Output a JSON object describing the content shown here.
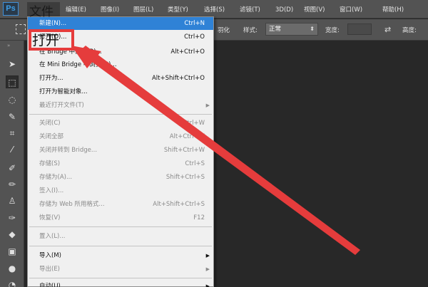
{
  "app": {
    "logo": "Ps"
  },
  "menubar": {
    "file_label": "文件",
    "items": [
      "编辑(E)",
      "图像(I)",
      "图层(L)",
      "类型(Y)",
      "选择(S)",
      "滤镜(T)",
      "3D(D)",
      "视图(V)",
      "窗口(W)",
      "帮助(H)"
    ]
  },
  "optbar": {
    "feather_label": "羽化",
    "style_label": "样式:",
    "style_value": "正常",
    "width_label": "宽度:",
    "height_label": "高度:"
  },
  "file_menu": {
    "items": [
      {
        "label": "新建(N)...",
        "shortcut": "Ctrl+N",
        "state": "highlight"
      },
      {
        "label": "打开(O)...",
        "shortcut": "Ctrl+O",
        "state": "normal"
      },
      {
        "label": "在 Bridge 中浏览(B)...",
        "shortcut": "Alt+Ctrl+O",
        "state": "normal"
      },
      {
        "label": "在 Mini Bridge 中浏览(G)...",
        "shortcut": "",
        "state": "normal"
      },
      {
        "label": "打开为...",
        "shortcut": "Alt+Shift+Ctrl+O",
        "state": "normal"
      },
      {
        "label": "打开为智能对象...",
        "shortcut": "",
        "state": "normal"
      },
      {
        "label": "最近打开文件(T)",
        "shortcut": "",
        "state": "disabled",
        "submenu": true
      },
      {
        "label": "关闭(C)",
        "shortcut": "Ctrl+W",
        "state": "disabled"
      },
      {
        "label": "关闭全部",
        "shortcut": "Alt+Ctrl+W",
        "state": "disabled"
      },
      {
        "label": "关闭并转到 Bridge...",
        "shortcut": "Shift+Ctrl+W",
        "state": "disabled"
      },
      {
        "label": "存储(S)",
        "shortcut": "Ctrl+S",
        "state": "disabled"
      },
      {
        "label": "存储为(A)...",
        "shortcut": "Shift+Ctrl+S",
        "state": "disabled"
      },
      {
        "label": "签入(I)...",
        "shortcut": "",
        "state": "disabled"
      },
      {
        "label": "存储为 Web 所用格式...",
        "shortcut": "Alt+Shift+Ctrl+S",
        "state": "disabled"
      },
      {
        "label": "恢复(V)",
        "shortcut": "F12",
        "state": "disabled"
      },
      {
        "label": "置入(L)...",
        "shortcut": "",
        "state": "disabled"
      },
      {
        "label": "导入(M)",
        "shortcut": "",
        "state": "normal",
        "submenu": true
      },
      {
        "label": "导出(E)",
        "shortcut": "",
        "state": "disabled",
        "submenu": true
      },
      {
        "label": "自动(U)",
        "shortcut": "",
        "state": "normal",
        "submenu": true
      }
    ]
  },
  "annotation": {
    "text": "打开",
    "color": "#e53c3c"
  },
  "colors": {
    "highlight": "#2f82d6",
    "panel": "#535353",
    "canvas": "#282828",
    "accent_red": "#e53c3c"
  }
}
